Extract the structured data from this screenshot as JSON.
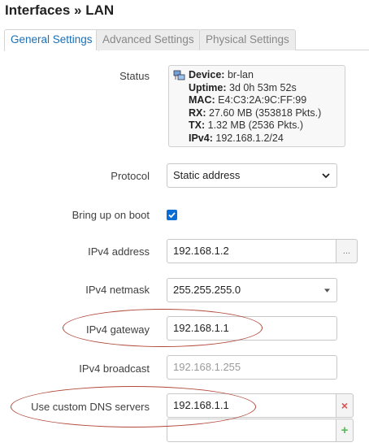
{
  "page": {
    "title": "Interfaces » LAN"
  },
  "tabs": [
    {
      "label": "General Settings",
      "active": true
    },
    {
      "label": "Advanced Settings",
      "active": false
    },
    {
      "label": "Physical Settings",
      "active": false
    }
  ],
  "status": {
    "label": "Status",
    "device_key": "Device:",
    "device_val": "br-lan",
    "uptime_key": "Uptime:",
    "uptime_val": "3d 0h 53m 52s",
    "mac_key": "MAC:",
    "mac_val": "E4:C3:2A:9C:FF:99",
    "rx_key": "RX:",
    "rx_val": "27.60 MB (353818 Pkts.)",
    "tx_key": "TX:",
    "tx_val": "1.32 MB (2536 Pkts.)",
    "ipv4_key": "IPv4:",
    "ipv4_val": "192.168.1.2/24",
    "icon": "network-device-icon"
  },
  "protocol": {
    "label": "Protocol",
    "value": "Static address"
  },
  "boot": {
    "label": "Bring up on boot",
    "checked": true
  },
  "ipv4_address": {
    "label": "IPv4 address",
    "value": "192.168.1.2",
    "button": "..."
  },
  "ipv4_netmask": {
    "label": "IPv4 netmask",
    "value": "255.255.255.0"
  },
  "ipv4_gateway": {
    "label": "IPv4 gateway",
    "value": "192.168.1.1"
  },
  "ipv4_broadcast": {
    "label": "IPv4 broadcast",
    "placeholder": "192.168.1.255"
  },
  "dns": {
    "label": "Use custom DNS servers",
    "value": "192.168.1.1",
    "remove": "×",
    "add": "+"
  },
  "colors": {
    "accent": "#1a6fb5",
    "remove": "#d9534f",
    "add": "#5cb85c",
    "annotation": "#b0483a"
  }
}
